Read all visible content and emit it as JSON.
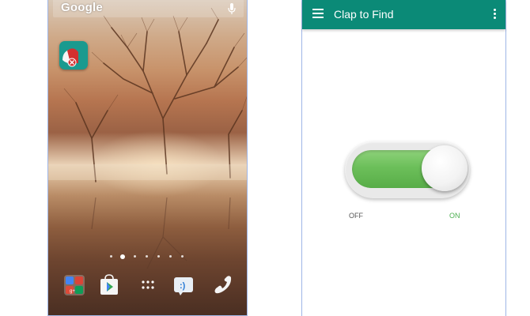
{
  "home_screen": {
    "search_bar": {
      "logo_text": "Google",
      "icon": "microphone-icon"
    },
    "shortcut_icon": "clap-to-find-app-icon",
    "page_indicator": {
      "count": 7,
      "active_index": 1
    },
    "dock": [
      "google-apps-folder-icon",
      "play-store-icon",
      "app-drawer-icon",
      "messenger-icon",
      "phone-icon"
    ]
  },
  "app": {
    "title": "Clap to Find",
    "menu_icon": "hamburger-menu-icon",
    "overflow_icon": "more-vert-icon",
    "switch": {
      "state": "on",
      "off_label": "OFF",
      "on_label": "ON"
    }
  },
  "colors": {
    "app_bar": "#0b8a77",
    "switch_on": "#6cbf5a",
    "on_label": "#4caf50",
    "phone_border": "#9fb6e6"
  }
}
